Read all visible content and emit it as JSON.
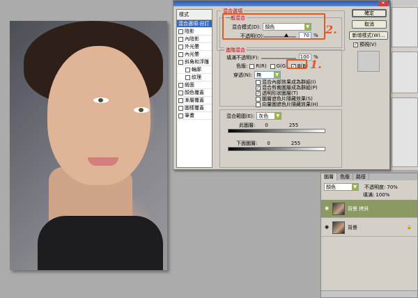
{
  "dialog": {
    "styles_header": "樣式",
    "style_items": [
      {
        "label": "混合選項:自訂",
        "checked": false,
        "selected": true,
        "indent": false
      },
      {
        "label": "陰影",
        "checked": false,
        "selected": false,
        "indent": false
      },
      {
        "label": "內陰影",
        "checked": false,
        "selected": false,
        "indent": false
      },
      {
        "label": "外光暈",
        "checked": false,
        "selected": false,
        "indent": false
      },
      {
        "label": "內光暈",
        "checked": false,
        "selected": false,
        "indent": false
      },
      {
        "label": "斜角和浮雕",
        "checked": false,
        "selected": false,
        "indent": false
      },
      {
        "label": "輪廓",
        "checked": false,
        "selected": false,
        "indent": true
      },
      {
        "label": "紋理",
        "checked": false,
        "selected": false,
        "indent": true
      },
      {
        "label": "緞面",
        "checked": false,
        "selected": false,
        "indent": false
      },
      {
        "label": "顏色覆蓋",
        "checked": false,
        "selected": false,
        "indent": false
      },
      {
        "label": "漸層覆蓋",
        "checked": false,
        "selected": false,
        "indent": false
      },
      {
        "label": "圖樣覆蓋",
        "checked": false,
        "selected": false,
        "indent": false
      },
      {
        "label": "筆畫",
        "checked": false,
        "selected": false,
        "indent": false
      }
    ],
    "blend_options_title": "混合選項",
    "general_blend_label": "一般混合",
    "blend_mode_label": "混合模式(D):",
    "blend_mode_value": "顏色",
    "opacity_label": "不透明(O):",
    "opacity_value": "70",
    "opacity_unit": "%",
    "opacity_level": 0.7,
    "advanced_blend_label": "進階混合",
    "fill_opacity_label": "填滿不透明(F):",
    "fill_opacity_value": "100",
    "fill_opacity_unit": "%",
    "channels_label": "色版:",
    "channel_r": "R(R)",
    "channel_g": "G(G)",
    "channel_b": "B(B)",
    "knockout_label": "穿透(N):",
    "knockout_value": "無",
    "options": [
      {
        "label": "混合內部效果成為群組(I)",
        "checked": false
      },
      {
        "label": "混合剪裁圖層成為群組(P)",
        "checked": true
      },
      {
        "label": "透明形狀圖層(T)",
        "checked": true
      },
      {
        "label": "圖層遮色片隱藏效果(S)",
        "checked": false
      },
      {
        "label": "向量圖遮色片隱藏效果(H)",
        "checked": false
      }
    ],
    "blend_if_label": "混合範圍(E):",
    "blend_if_value": "灰色",
    "this_layer_label": "此圖層:",
    "this_layer_min": "0",
    "this_layer_max": "255",
    "underlying_label": "下面圖層:",
    "underlying_min": "0",
    "underlying_max": "255",
    "ok_label": "確定",
    "cancel_label": "取消",
    "new_style_label": "新增樣式(W)...",
    "preview_label": "預視(V)",
    "preview_checked": true,
    "annotation_1": "1.",
    "annotation_2": "2."
  },
  "layers_panel": {
    "tabs": [
      "圖層",
      "色版",
      "路徑"
    ],
    "blend_mode": "顏色",
    "opacity_label": "不透明度:",
    "opacity_value": "70%",
    "fill_label": "填滿:",
    "fill_value": "100%",
    "layers": [
      {
        "name": "背景 拷貝",
        "selected": true
      },
      {
        "name": "背景",
        "selected": false
      }
    ]
  },
  "colors": {
    "annotation": "#e8571f",
    "layer_selected": "#8a9a62",
    "dialog_bg": "#d4d0c8"
  }
}
